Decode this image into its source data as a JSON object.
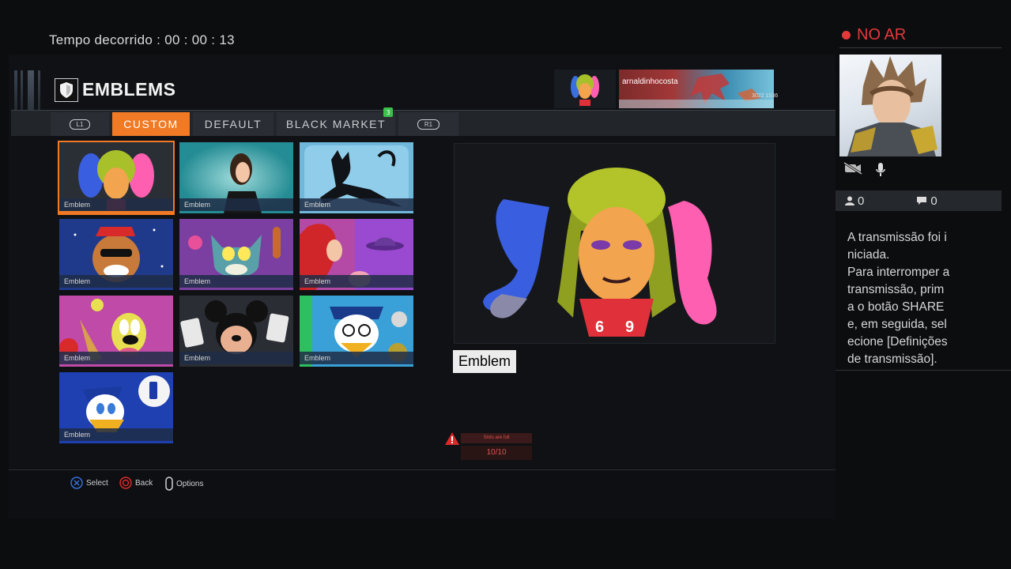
{
  "stream": {
    "elapsed_label": "Tempo decorrido : 00 : 00 : 13",
    "live_label": "NO AR",
    "viewers": "0",
    "comments": "0",
    "info_text": "A transmissão foi i\nniciada.\nPara interromper a\ntransmissão, prim\na o botão SHARE\ne, em seguida, sel\necione [Definições\nde transmissão]."
  },
  "header": {
    "title": "EMBLEMS",
    "player_name": "arnaldinhocosta",
    "player_id": "3022.1536"
  },
  "tabs": {
    "left_bumper": "L1",
    "custom": "CUSTOM",
    "default": "DEFAULT",
    "black_market": "BLACK MARKET",
    "black_market_badge": "3",
    "right_bumper": "R1"
  },
  "emblems": [
    {
      "label": "Emblem",
      "icon": "harley-quinn-icon"
    },
    {
      "label": "Emblem",
      "icon": "woman-portrait-icon"
    },
    {
      "label": "Emblem",
      "icon": "catwoman-icon"
    },
    {
      "label": "Emblem",
      "icon": "beagle-boy-icon"
    },
    {
      "label": "Emblem",
      "icon": "tom-cat-icon"
    },
    {
      "label": "Emblem",
      "icon": "jessica-rabbit-icon"
    },
    {
      "label": "Emblem",
      "icon": "goofy-icon"
    },
    {
      "label": "Emblem",
      "icon": "mickey-icon"
    },
    {
      "label": "Emblem",
      "icon": "scrooge-icon"
    },
    {
      "label": "Emblem",
      "icon": "donald-icon"
    }
  ],
  "preview": {
    "name": "Emblem",
    "icon": "harley-quinn-icon"
  },
  "slots": {
    "warning": "Slots are full",
    "count": "10/10"
  },
  "footer": {
    "select": "Select",
    "back": "Back",
    "options": "Options"
  },
  "colors": {
    "accent": "#f07a25",
    "live": "#e23a3a",
    "badge": "#3ac04b"
  }
}
